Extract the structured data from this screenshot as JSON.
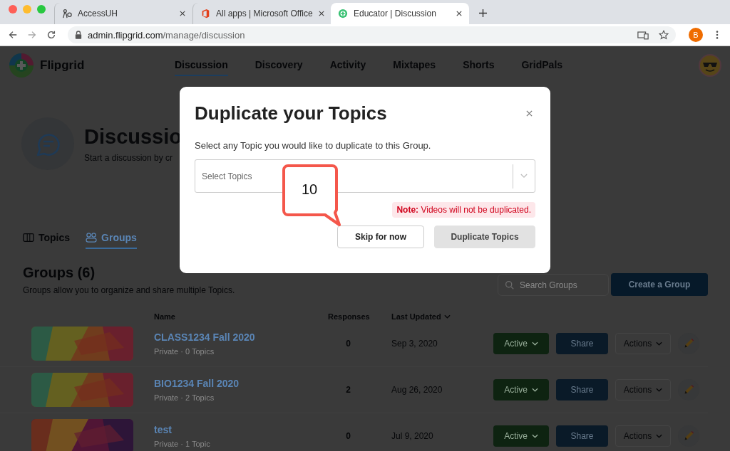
{
  "browser": {
    "tabs": [
      {
        "title": "AccessUH",
        "selected": false
      },
      {
        "title": "All apps | Microsoft Office",
        "selected": false
      },
      {
        "title": "Educator | Discussion",
        "selected": true
      }
    ],
    "address": {
      "domain": "admin.flipgrid.com",
      "path": "/manage/discussion"
    },
    "profile_initial": "B"
  },
  "app": {
    "logo": "Flipgrid",
    "nav": [
      {
        "label": "Discussion",
        "selected": true
      },
      {
        "label": "Discovery",
        "selected": false
      },
      {
        "label": "Activity",
        "selected": false
      },
      {
        "label": "Mixtapes",
        "selected": false
      },
      {
        "label": "Shorts",
        "selected": false
      },
      {
        "label": "GridPals",
        "selected": false
      }
    ],
    "hero": {
      "title": "Discussio",
      "subtitle": "Start a discussion by cr"
    },
    "tabs": [
      {
        "label": "Topics",
        "selected": false
      },
      {
        "label": "Groups",
        "selected": true
      }
    ],
    "groups": {
      "title": "Groups (6)",
      "description": "Groups allow you to organize and share multiple Topics.",
      "search": {
        "placeholder": "Search Groups"
      },
      "create_button": "Create a Group",
      "columns": [
        "Name",
        "Responses",
        "Last Updated"
      ],
      "rows": [
        {
          "name": "CLASS1234 Fall 2020",
          "meta": "Private · 0 Topics",
          "responses": "0",
          "updated": "Sep 3, 2020",
          "status": "Active",
          "share": "Share",
          "actions": "Actions"
        },
        {
          "name": "BIO1234 Fall 2020",
          "meta": "Private · 2 Topics",
          "responses": "2",
          "updated": "Aug 26, 2020",
          "status": "Active",
          "share": "Share",
          "actions": "Actions"
        },
        {
          "name": "test",
          "meta": "Private · 1 Topic",
          "responses": "0",
          "updated": "Jul 9, 2020",
          "status": "Active",
          "share": "Share",
          "actions": "Actions"
        }
      ]
    }
  },
  "modal": {
    "title": "Duplicate your Topics",
    "instructions": "Select any Topic you would like to duplicate to this Group.",
    "select": {
      "placeholder": "Select Topics"
    },
    "note": "**Note:** Videos will not be duplicated.",
    "buttons": [
      {
        "label": "Skip for now",
        "disabled": false
      },
      {
        "label": "Duplicate Topics",
        "disabled": true
      }
    ]
  },
  "annotation": {
    "label": "10"
  }
}
